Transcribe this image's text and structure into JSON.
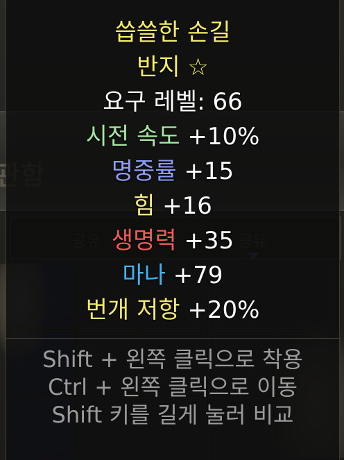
{
  "background": {
    "stash_label": "관함",
    "tabs": [
      "공유",
      "공유"
    ]
  },
  "item": {
    "name": "씁쓸한 손길",
    "type": "반지 ☆",
    "required_level": "요구 레벨: 66",
    "stats": [
      {
        "label": "시전 속도",
        "value": "+10%",
        "color": "#a8e6a3"
      },
      {
        "label": "명중률",
        "value": "+15",
        "color": "#8e9ef5"
      },
      {
        "label": "힘",
        "value": "+16",
        "color": "#f3ea82"
      },
      {
        "label": "생명력",
        "value": "+35",
        "color": "#f25a5a"
      },
      {
        "label": "마나",
        "value": "+79",
        "color": "#3fb4f0"
      },
      {
        "label": "번개 저항",
        "value": "+20%",
        "color": "#f3ea72"
      }
    ],
    "name_color": "#f5ec6a",
    "type_color": "#f5ec6a"
  },
  "hints": [
    "Shift + 왼쪽 클릭으로 착용",
    "Ctrl + 왼쪽 클릭으로 이동",
    "Shift 키를 길게 눌러 비교"
  ]
}
